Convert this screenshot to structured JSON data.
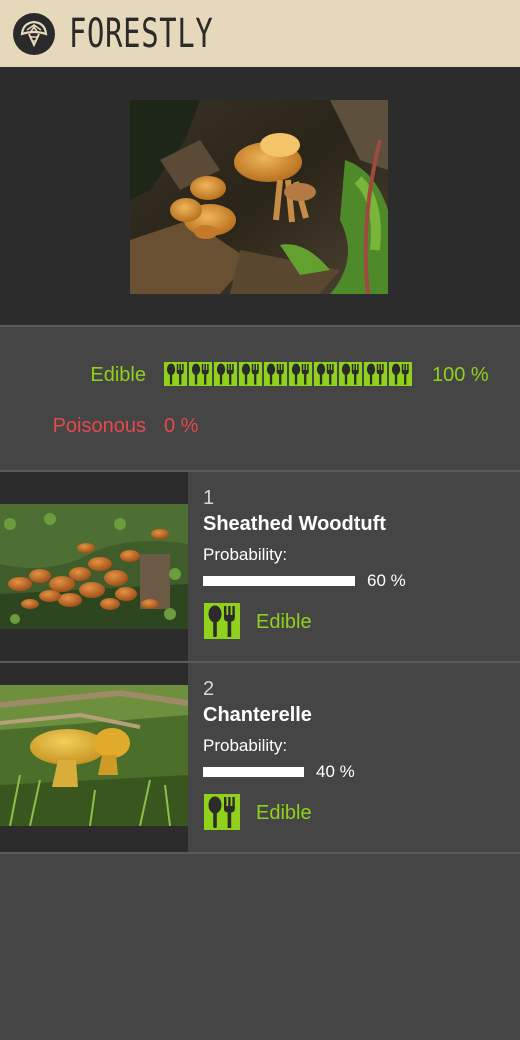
{
  "header": {
    "brand": "FORESTLY",
    "logo_icon": "mushroom-logo-icon"
  },
  "hero": {
    "photo_description_icon": "mushroom-photo"
  },
  "summary": {
    "edible_label": "Edible",
    "edible_percent": "100 %",
    "edible_fraction": 1.0,
    "poisonous_label": "Poisonous",
    "poisonous_percent": "0 %",
    "poisonous_fraction": 0.0,
    "meter_icon": "spoon-fork-icon"
  },
  "results": [
    {
      "rank": "1",
      "name": "Sheathed Woodtuft",
      "probability_label": "Probability:",
      "probability_percent": "60 %",
      "probability": 0.6,
      "edibility": "Edible",
      "edibility_icon": "spoon-fork-icon"
    },
    {
      "rank": "2",
      "name": "Chanterelle",
      "probability_label": "Probability:",
      "probability_percent": "40 %",
      "probability": 0.4,
      "edibility": "Edible",
      "edibility_icon": "spoon-fork-icon"
    }
  ],
  "colors": {
    "header_bg": "#e6d8bb",
    "edible": "#8fd11b",
    "poisonous": "#e74848",
    "panel": "#454545",
    "photo_bg": "#2c2c2c"
  }
}
